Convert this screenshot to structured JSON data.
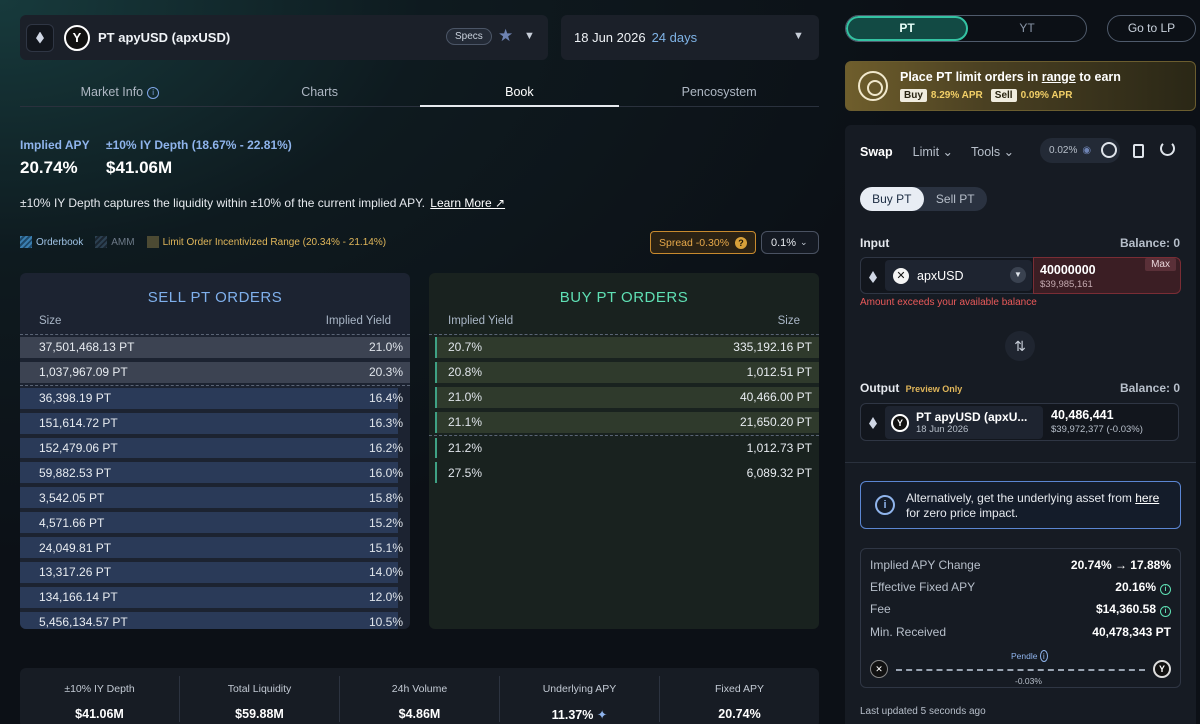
{
  "header": {
    "market_name": "PT apyUSD (apxUSD)",
    "specs_label": "Specs",
    "maturity_date": "18 Jun 2026",
    "days_left": "24 days"
  },
  "tabs": [
    {
      "label": "Market Info"
    },
    {
      "label": "Charts"
    },
    {
      "label": "Book"
    },
    {
      "label": "Pencosystem"
    }
  ],
  "summary": {
    "implied_apy_label": "Implied APY",
    "implied_apy_value": "20.74%",
    "depth_label": "±10% IY Depth (18.67% - 22.81%)",
    "depth_value": "$41.06M",
    "description": "±10% IY Depth captures the liquidity within ±10% of the current implied APY.",
    "learn_more": "Learn More ↗"
  },
  "legend": {
    "orderbook": "Orderbook",
    "amm": "AMM",
    "incentivized": "Limit Order Incentivized Range (20.34% - 21.14%)"
  },
  "spread": "Spread -0.30%",
  "precision": "0.1%",
  "sell_book": {
    "title": "SELL PT ORDERS",
    "col_size": "Size",
    "col_iy": "Implied Yield",
    "rows": [
      {
        "size": "37,501,468.13 PT",
        "iy": "21.0%",
        "fill": 1.0
      },
      {
        "size": "1,037,967.09 PT",
        "iy": "20.3%",
        "fill": 1.0
      },
      {
        "size": "36,398.19 PT",
        "iy": "16.4%",
        "fill": 0.97
      },
      {
        "size": "151,614.72 PT",
        "iy": "16.3%",
        "fill": 0.97
      },
      {
        "size": "152,479.06 PT",
        "iy": "16.2%",
        "fill": 0.97
      },
      {
        "size": "59,882.53 PT",
        "iy": "16.0%",
        "fill": 0.97
      },
      {
        "size": "3,542.05 PT",
        "iy": "15.8%",
        "fill": 0.97
      },
      {
        "size": "4,571.66 PT",
        "iy": "15.2%",
        "fill": 0.97
      },
      {
        "size": "24,049.81 PT",
        "iy": "15.1%",
        "fill": 0.97
      },
      {
        "size": "13,317.26 PT",
        "iy": "14.0%",
        "fill": 0.97
      },
      {
        "size": "134,166.14 PT",
        "iy": "12.0%",
        "fill": 0.97
      },
      {
        "size": "5,456,134.57 PT",
        "iy": "10.5%",
        "fill": 0.97
      }
    ]
  },
  "buy_book": {
    "title": "BUY PT ORDERS",
    "col_iy": "Implied Yield",
    "col_size": "Size",
    "rows": [
      {
        "iy": "20.7%",
        "size": "335,192.16 PT"
      },
      {
        "iy": "20.8%",
        "size": "1,012.51 PT"
      },
      {
        "iy": "21.0%",
        "size": "40,466.00 PT"
      },
      {
        "iy": "21.1%",
        "size": "21,650.20 PT"
      },
      {
        "iy": "21.2%",
        "size": "1,012.73 PT"
      },
      {
        "iy": "27.5%",
        "size": "6,089.32 PT"
      }
    ]
  },
  "stats": [
    {
      "label": "±10% IY Depth",
      "value": "$41.06M"
    },
    {
      "label": "Total Liquidity",
      "value": "$59.88M"
    },
    {
      "label": "24h Volume",
      "value": "$4.86M"
    },
    {
      "label": "Underlying APY",
      "value": "11.37%"
    },
    {
      "label": "Fixed APY",
      "value": "20.74%"
    }
  ],
  "right": {
    "pt_label": "PT",
    "yt_label": "YT",
    "go_to_lp": "Go to LP",
    "promo_text_a": "Place PT limit orders in ",
    "promo_text_range": "range",
    "promo_text_b": " to earn",
    "promo_buy": "Buy",
    "promo_buy_apr": "8.29% APR",
    "promo_sell": "Sell",
    "promo_sell_apr": "0.09% APR",
    "swap": "Swap",
    "limit": "Limit ⌄",
    "tools": "Tools ⌄",
    "slippage": "0.02%",
    "buy_pt": "Buy PT",
    "sell_pt": "Sell PT",
    "input_label": "Input",
    "input_balance": "Balance: 0",
    "input_token": "apxUSD",
    "input_amount": "40000000",
    "input_usd": "$39,985,161",
    "max": "Max",
    "error": "Amount exceeds your available balance",
    "output_label": "Output",
    "preview_only": "Preview Only",
    "output_balance": "Balance: 0",
    "output_token": "PT apyUSD (apxU...",
    "output_date": "18 Jun 2026",
    "output_amount": "40,486,441",
    "output_usd": "$39,972,377 (-0.03%)",
    "alt_text_a": "Alternatively, get the underlying asset from ",
    "alt_link": "here",
    "alt_text_b": " for zero price impact.",
    "implied_change_label": "Implied APY Change",
    "implied_change_value": "20.74% → 17.88%",
    "effective_label": "Effective Fixed APY",
    "effective_value": "20.16%",
    "fee_label": "Fee",
    "fee_value": "$14,360.58",
    "min_label": "Min. Received",
    "min_value": "40,478,343 PT",
    "route_name": "Pendle",
    "route_pct": "-0.03%",
    "updated": "Last updated 5 seconds ago"
  },
  "colors": {
    "sell_accent": "#7fb0ec",
    "buy_accent": "#5fe0b4",
    "error": "#ea5a5a",
    "promo_gold": "#f3d067"
  }
}
